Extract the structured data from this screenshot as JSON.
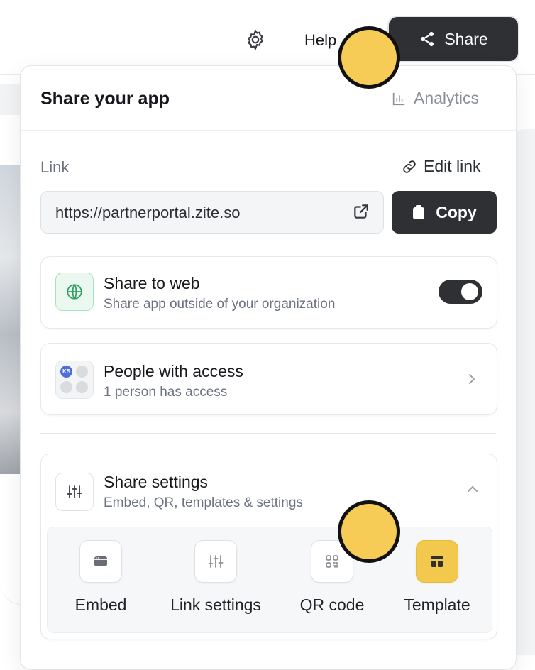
{
  "header": {
    "help_label": "Help",
    "share_label": "Share"
  },
  "panel": {
    "title": "Share your app",
    "analytics_label": "Analytics",
    "link_label": "Link",
    "edit_link_label": "Edit link",
    "url": "https://partnerportal.zite.so",
    "copy_label": "Copy"
  },
  "share_to_web": {
    "title": "Share to web",
    "subtitle": "Share app outside of your organization",
    "enabled": true
  },
  "people": {
    "title": "People with access",
    "subtitle": "1 person has access",
    "avatar_initials": "KS"
  },
  "settings": {
    "title": "Share settings",
    "subtitle": "Embed, QR, templates & settings",
    "options": [
      {
        "label": "Embed",
        "icon": "embed-icon"
      },
      {
        "label": "Link settings",
        "icon": "sliders-icon"
      },
      {
        "label": "QR code",
        "icon": "qr-code-icon"
      },
      {
        "label": "Template",
        "icon": "template-icon",
        "active": true
      }
    ]
  },
  "colors": {
    "dark_button": "#2f3033",
    "accent_yellow": "#f2c94c",
    "web_icon_bg": "#ebf8f0",
    "marker": "#f6cb56"
  }
}
